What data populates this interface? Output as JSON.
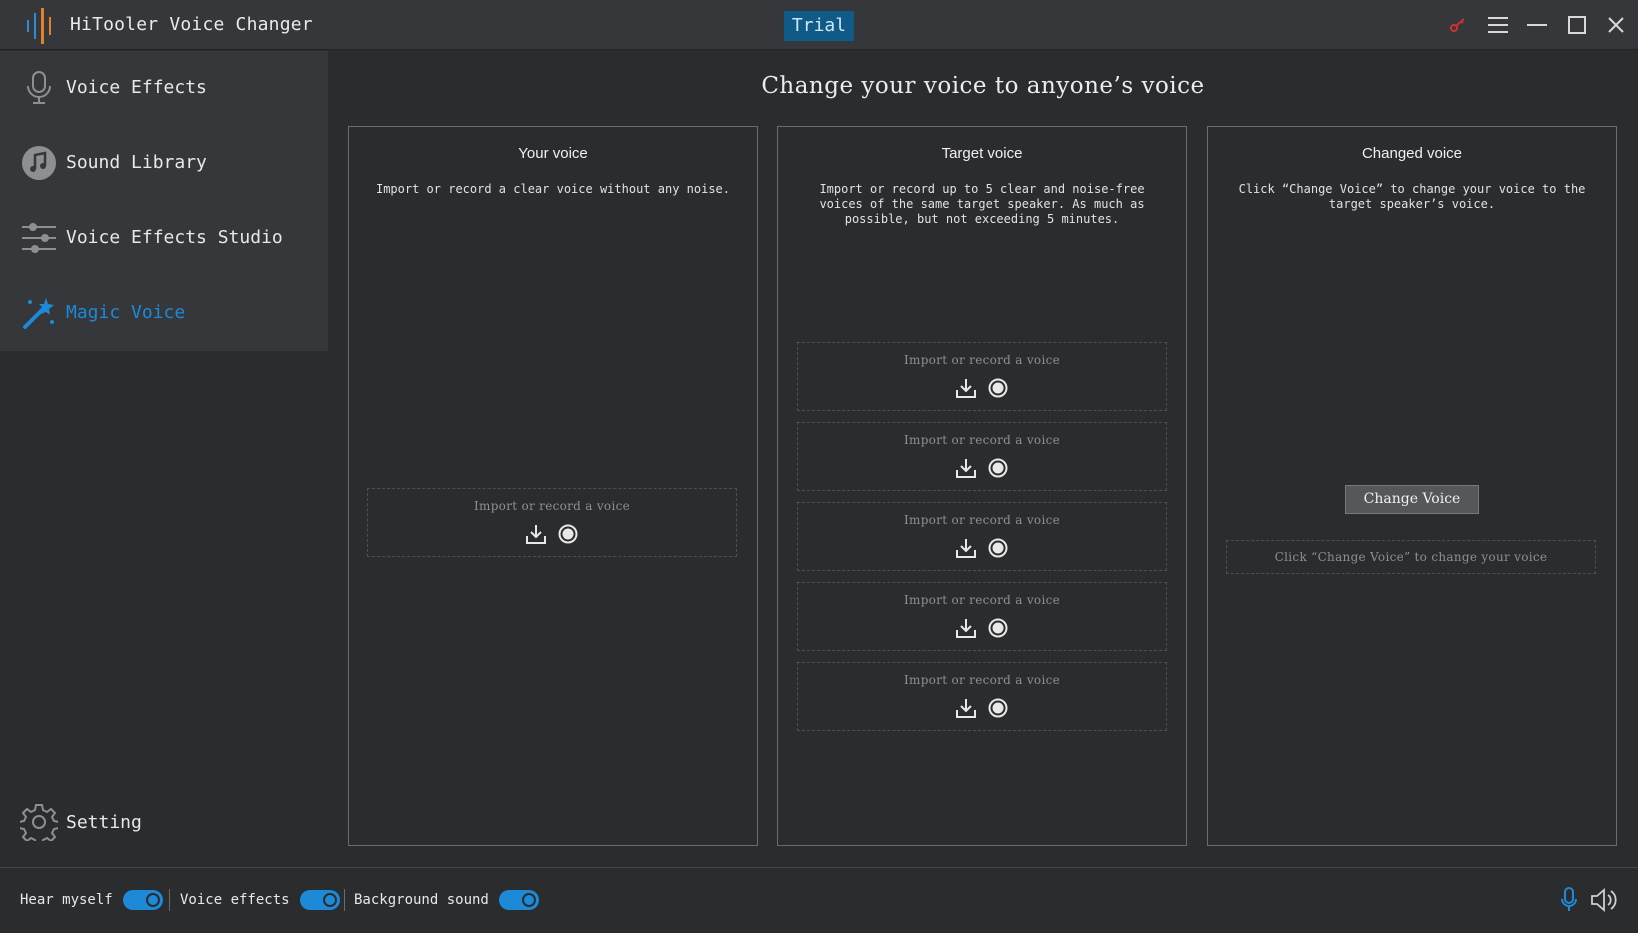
{
  "app": {
    "title": "HiTooler Voice Changer",
    "badge": "Trial"
  },
  "sidebar": {
    "items": [
      {
        "label": "Voice Effects",
        "icon": "microphone-icon"
      },
      {
        "label": "Sound Library",
        "icon": "music-note-icon"
      },
      {
        "label": "Voice Effects Studio",
        "icon": "sliders-icon"
      },
      {
        "label": "Magic Voice",
        "icon": "magic-wand-icon",
        "active": true
      }
    ],
    "setting": {
      "label": "Setting",
      "icon": "gear-icon"
    }
  },
  "main": {
    "title": "Change your voice to anyone’s voice",
    "your_voice": {
      "title": "Your voice",
      "description": "Import or record a clear voice without any noise.",
      "slot_label": "Import or record a voice"
    },
    "target_voice": {
      "title": "Target voice",
      "description": "Import or record up to 5 clear and noise-free voices of the same target speaker. As much as possible, but not exceeding 5 minutes.",
      "slots": [
        {
          "label": "Import or record a voice"
        },
        {
          "label": "Import or record a voice"
        },
        {
          "label": "Import or record a voice"
        },
        {
          "label": "Import or record a voice"
        },
        {
          "label": "Import or record a voice"
        }
      ]
    },
    "changed_voice": {
      "title": "Changed voice",
      "description": "Click “Change Voice” to change your voice to the target speaker’s voice.",
      "button": "Change Voice",
      "hint": "Click “Change Voice” to change your voice"
    }
  },
  "bottom": {
    "toggles": [
      {
        "label": "Hear myself",
        "on": true
      },
      {
        "label": "Voice effects",
        "on": true
      },
      {
        "label": "Background sound",
        "on": true
      }
    ]
  },
  "colors": {
    "accent": "#1c8ad6",
    "badge_bg": "#0f5a86",
    "panel_border": "#6a6b6e",
    "key_red": "#d0312d"
  }
}
